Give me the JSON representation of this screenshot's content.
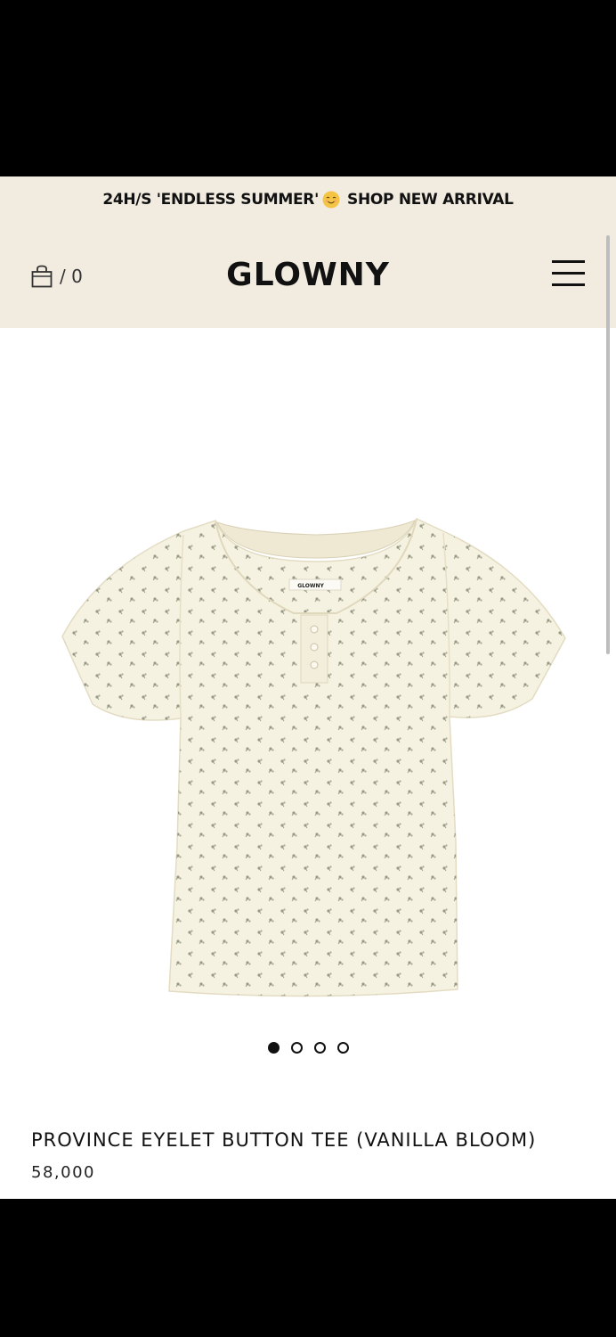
{
  "announcement": {
    "text_before": "24H/S 'ENDLESS SUMMER'",
    "emoji_icon": "smiling-sun-emoji",
    "text_after": "SHOP NEW ARRIVAL"
  },
  "header": {
    "cart_count": "/ 0",
    "brand": "GLOWNY",
    "menu_icon": "hamburger-menu-icon",
    "cart_icon": "shopping-bag-icon"
  },
  "product": {
    "image_label": "GLOWNY",
    "title": "PROVINCE EYELET BUTTON TEE (VANILLA BLOOM)",
    "price": "58,000",
    "carousel_count": 4,
    "carousel_active_index": 0
  },
  "colors": {
    "header_bg": "#f1ebe0",
    "tee": "#f6f2e1",
    "dot_active": "#111111"
  }
}
